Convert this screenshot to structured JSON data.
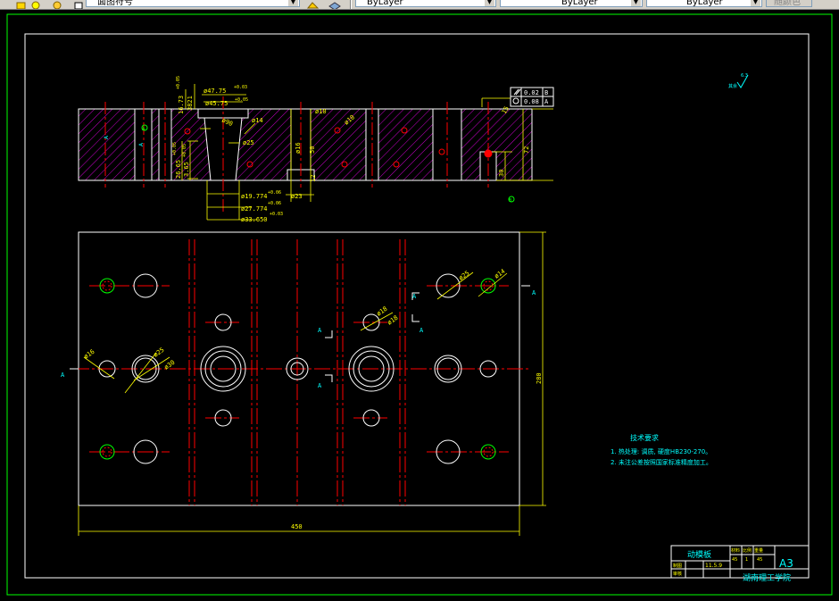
{
  "toolbar": {
    "layer_combo": "面图符号",
    "color_combo": "ByLayer",
    "linetype_combo": "ByLayer",
    "lineweight_combo": "ByLayer",
    "plot_style_combo": "随颜色"
  },
  "colors": {
    "background": "#000000",
    "border": "#00ff00",
    "outline": "#ffffff",
    "hatch": "#ff00ff",
    "centerline": "#ff0000",
    "dimension": "#ffff00",
    "section_mark": "#00ffff",
    "hole": "#ff0000"
  },
  "section_view": {
    "dims": {
      "d47": "ø47.75",
      "d47_tol": "+0.03",
      "d45": "ø45.75",
      "d45_tol": "+0.05",
      "d16": "16.73",
      "d16_tol": "+0.05",
      "d3821": "3821",
      "d14": "ø14",
      "d25": "ø25",
      "d90": "ø90",
      "d10": "ø10",
      "d10a": "ø10",
      "dim12": "12",
      "dim16": "ø16",
      "dim50": "50",
      "dim72": "72",
      "dim30": "30",
      "dim15": "15",
      "dim23": "ø23",
      "dim8": "8",
      "d1977": "ø19.774",
      "d1977_tol": "+0.06",
      "d2777": "ø27.774",
      "d2777_tol": "+0.06",
      "d3365": "ø33.650",
      "d3365_tol": "+0.03",
      "d2665": "26.65",
      "d2665_tol": "+0.05",
      "d2665b": "3.65",
      "d2665b_tol": "+0.05",
      "dimA": "A",
      "dimA2": "A"
    },
    "tolerance_frame": {
      "row1_value": "0.02",
      "row1_datum": "B",
      "row2_value": "0.08",
      "row2_datum": "A"
    },
    "roughness": "6.3",
    "roughness_prefix": "其余",
    "datum_b": "B"
  },
  "plan_view": {
    "width_dim": "450",
    "height_dim": "280",
    "labels": {
      "d16": "ø16",
      "d25": "ø25",
      "d30": "ø30",
      "d14": "ø14",
      "d25b": "ø25",
      "d18a": "ø18",
      "d18b": "ø18"
    },
    "section_marks": [
      "A",
      "A",
      "A",
      "A",
      "A",
      "A"
    ]
  },
  "tech_notes": {
    "title": "技术要求",
    "line1": "1. 热处理: 调质, 硬度HB230-270。",
    "line2": "2. 未注公差按照国家标准精度加工。"
  },
  "title_block": {
    "part_name": "动模板",
    "format": "A3",
    "material_label": "材料",
    "scale_label": "比例",
    "weight_label": "重量",
    "material_value": "45",
    "scale_value": "1",
    "weight_value": "45",
    "drawn_label": "制图",
    "checked_label": "审核",
    "date": "11.5.9",
    "school": "湖南理工学院"
  }
}
